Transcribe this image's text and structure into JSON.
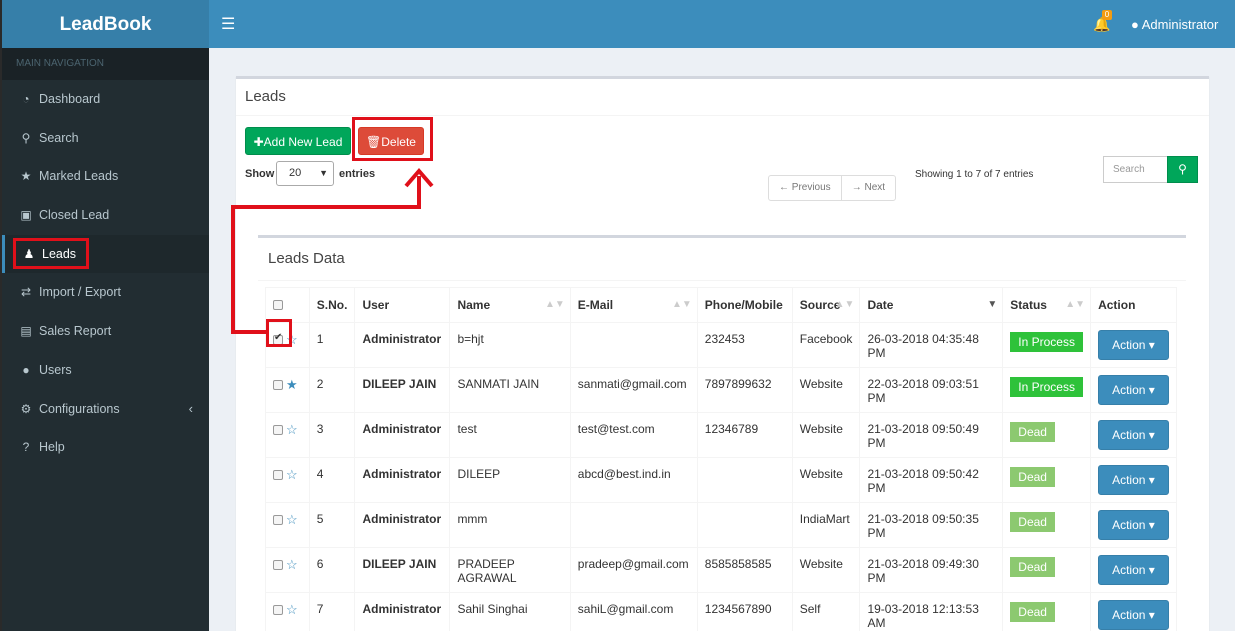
{
  "app": {
    "name": "LeadBook"
  },
  "topbar": {
    "menu_icon": "bars-icon",
    "notif_count": "0",
    "user": "Administrator"
  },
  "sidebar": {
    "header": "MAIN NAVIGATION",
    "items": [
      {
        "label": "Dashboard",
        "icon": "dashboard-icon"
      },
      {
        "label": "Search",
        "icon": "search-icon"
      },
      {
        "label": "Marked Leads",
        "icon": "star-icon"
      },
      {
        "label": "Closed Lead",
        "icon": "lock-icon"
      },
      {
        "label": "Leads",
        "icon": "users-icon"
      },
      {
        "label": "Import / Export",
        "icon": "exchange-icon"
      },
      {
        "label": "Sales Report",
        "icon": "money-icon"
      },
      {
        "label": "Users",
        "icon": "user-icon"
      },
      {
        "label": "Configurations",
        "icon": "cogs-icon"
      },
      {
        "label": "Help",
        "icon": "question-icon"
      }
    ]
  },
  "leads": {
    "title": "Leads",
    "add_label": "Add New Lead",
    "delete_label": "Delete",
    "show_label": "Show",
    "page_size": "20",
    "entries_label": "entries",
    "prev_label": "← Previous",
    "next_label": "→ Next",
    "showing_text": "Showing 1 to 7 of 7 entries",
    "search_placeholder": "Search"
  },
  "table": {
    "title": "Leads Data",
    "headers": {
      "sno": "S.No.",
      "user": "User",
      "name": "Name",
      "email": "E-Mail",
      "phone": "Phone/Mobile",
      "source": "Source",
      "date": "Date",
      "status": "Status",
      "action": "Action"
    },
    "action_label": "Action",
    "rows": [
      {
        "sno": "1",
        "user": "Administrator",
        "name": "b=hjt",
        "email": "",
        "phone": "232453",
        "source": "Facebook",
        "date": "26-03-2018 04:35:48 PM",
        "status": "In Process"
      },
      {
        "sno": "2",
        "user": "DILEEP JAIN",
        "name": "SANMATI JAIN",
        "email": "sanmati@gmail.com",
        "phone": "7897899632",
        "source": "Website",
        "date": "22-03-2018 09:03:51 PM",
        "status": "In Process"
      },
      {
        "sno": "3",
        "user": "Administrator",
        "name": "test",
        "email": "test@test.com",
        "phone": "12346789",
        "source": "Website",
        "date": "21-03-2018 09:50:49 PM",
        "status": "Dead"
      },
      {
        "sno": "4",
        "user": "Administrator",
        "name": "DILEEP",
        "email": "abcd@best.ind.in",
        "phone": "",
        "source": "Website",
        "date": "21-03-2018 09:50:42 PM",
        "status": "Dead"
      },
      {
        "sno": "5",
        "user": "Administrator",
        "name": "mmm",
        "email": "",
        "phone": "",
        "source": "IndiaMart",
        "date": "21-03-2018 09:50:35 PM",
        "status": "Dead"
      },
      {
        "sno": "6",
        "user": "DILEEP JAIN",
        "name": "PRADEEP AGRAWAL",
        "email": "pradeep@gmail.com",
        "phone": "8585858585",
        "source": "Website",
        "date": "21-03-2018 09:49:30 PM",
        "status": "Dead"
      },
      {
        "sno": "7",
        "user": "Administrator",
        "name": "Sahil Singhai",
        "email": "sahiL@gmail.com",
        "phone": "1234567890",
        "source": "Self",
        "date": "19-03-2018 12:13:53 AM",
        "status": "Dead"
      }
    ]
  }
}
